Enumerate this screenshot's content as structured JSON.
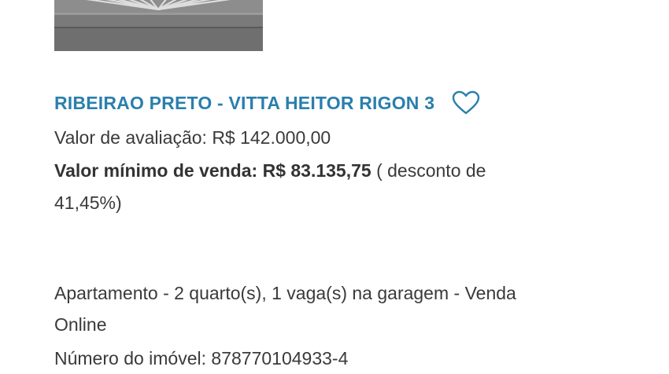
{
  "listing": {
    "title": "RIBEIRAO PRETO - VITTA HEITOR RIGON 3",
    "appraisal_label": "Valor de avaliação:",
    "appraisal_value": "R$ 142.000,00",
    "min_sale_label": "Valor mínimo de venda:",
    "min_sale_value": "R$ 83.135,75",
    "discount_prefix": "( desconto de",
    "discount_value": "41,45%)",
    "description_line1": "Apartamento - 2 quarto(s), 1 vaga(s) na garagem - Venda",
    "description_line2": "Online",
    "property_number_partial": "Número do imóvel: 878770104933-4"
  },
  "icons": {
    "favorite": "heart-outline-icon"
  },
  "colors": {
    "title": "#2a7fad",
    "text": "#3a3a3a"
  }
}
